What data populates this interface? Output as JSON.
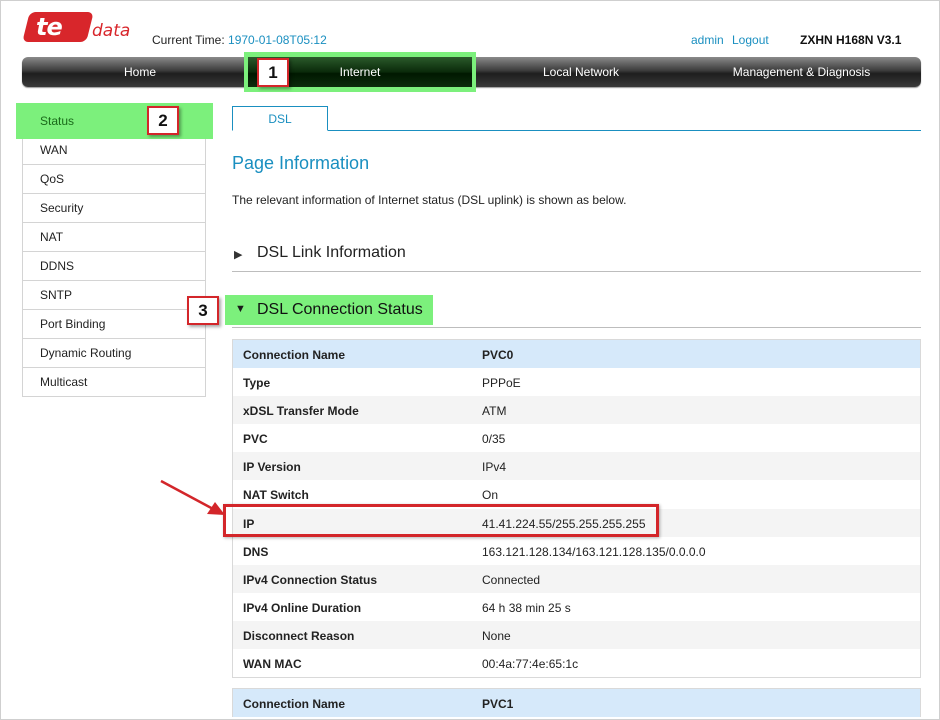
{
  "header": {
    "logo_main": "te",
    "logo_sub": "data",
    "current_time_label": "Current Time:",
    "current_time_value": "1970-01-08T05:12",
    "user_link": "admin",
    "logout_link": "Logout",
    "model": "ZXHN H168N V3.1"
  },
  "nav": {
    "items": [
      "Home",
      "Internet",
      "Local Network",
      "Management & Diagnosis"
    ],
    "active": "Internet"
  },
  "sidebar": {
    "items": [
      "Status",
      "WAN",
      "QoS",
      "Security",
      "NAT",
      "DDNS",
      "SNTP",
      "Port Binding",
      "Dynamic Routing",
      "Multicast"
    ],
    "active": "Status"
  },
  "content": {
    "tab": "DSL",
    "page_title": "Page Information",
    "page_desc": "The relevant information of Internet status (DSL uplink) is shown as below.",
    "section_link_info": "DSL Link Information",
    "section_conn_status": "DSL Connection Status",
    "table_rows": [
      {
        "key": "Connection Name",
        "value": "PVC0"
      },
      {
        "key": "Type",
        "value": "PPPoE"
      },
      {
        "key": "xDSL Transfer Mode",
        "value": "ATM"
      },
      {
        "key": "PVC",
        "value": "0/35"
      },
      {
        "key": "IP Version",
        "value": "IPv4"
      },
      {
        "key": "NAT Switch",
        "value": "On"
      },
      {
        "key": "IP",
        "value": "41.41.224.55/255.255.255.255"
      },
      {
        "key": "DNS",
        "value": "163.121.128.134/163.121.128.135/0.0.0.0"
      },
      {
        "key": "IPv4 Connection Status",
        "value": "Connected"
      },
      {
        "key": "IPv4 Online Duration",
        "value": "64 h 38 min 25 s"
      },
      {
        "key": "Disconnect Reason",
        "value": "None"
      },
      {
        "key": "WAN MAC",
        "value": "00:4a:77:4e:65:1c"
      }
    ],
    "table2_head": {
      "key": "Connection Name",
      "value": "PVC1"
    }
  },
  "annotations": {
    "badge_1": "1",
    "badge_2": "2",
    "badge_3": "3",
    "highlight_color": "#7cf07c",
    "marker_color": "#d3262a"
  },
  "icons": {
    "collapsed_arrow": "▶",
    "expanded_arrow": "▼"
  }
}
